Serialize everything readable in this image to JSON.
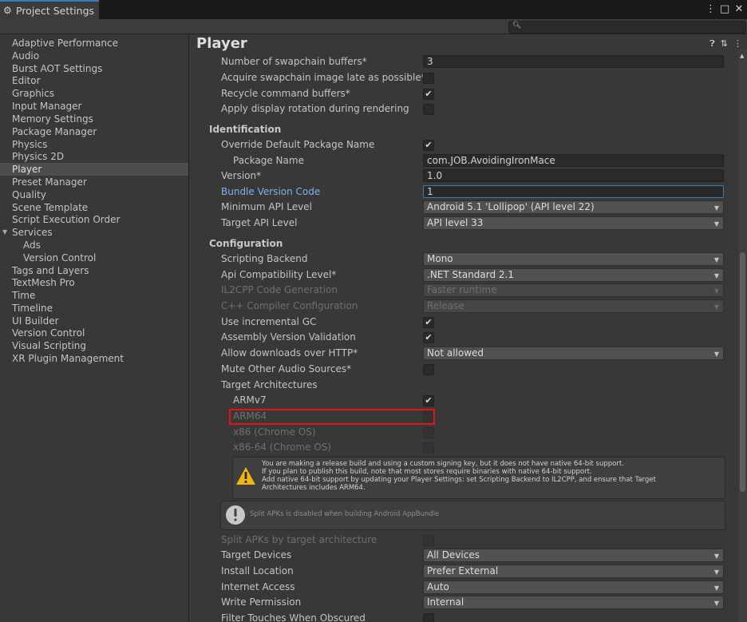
{
  "window": {
    "tab_title": "Project Settings",
    "controls": [
      "⋮",
      "□",
      "✕"
    ]
  },
  "search": {
    "placeholder": ""
  },
  "sidebar": {
    "items": [
      {
        "label": "Adaptive Performance"
      },
      {
        "label": "Audio"
      },
      {
        "label": "Burst AOT Settings"
      },
      {
        "label": "Editor"
      },
      {
        "label": "Graphics"
      },
      {
        "label": "Input Manager"
      },
      {
        "label": "Memory Settings"
      },
      {
        "label": "Package Manager"
      },
      {
        "label": "Physics"
      },
      {
        "label": "Physics 2D"
      },
      {
        "label": "Player",
        "selected": true
      },
      {
        "label": "Preset Manager"
      },
      {
        "label": "Quality"
      },
      {
        "label": "Scene Template"
      },
      {
        "label": "Script Execution Order"
      },
      {
        "label": "Services",
        "expanded": true
      },
      {
        "label": "Ads",
        "child": true
      },
      {
        "label": "Version Control",
        "child": true
      },
      {
        "label": "Tags and Layers"
      },
      {
        "label": "TextMesh Pro"
      },
      {
        "label": "Time"
      },
      {
        "label": "Timeline"
      },
      {
        "label": "UI Builder"
      },
      {
        "label": "Version Control"
      },
      {
        "label": "Visual Scripting"
      },
      {
        "label": "XR Plugin Management"
      }
    ]
  },
  "main": {
    "title": "Player",
    "header_icons": [
      "help-icon",
      "preset-icon",
      "more-icon"
    ],
    "rows": {
      "swapchain_buffers": {
        "label": "Number of swapchain buffers*",
        "value": "3"
      },
      "acquire_late": {
        "label": "Acquire swapchain image late as possible*",
        "checked": false
      },
      "recycle_buffers": {
        "label": "Recycle command buffers*",
        "checked": true
      },
      "display_rotation": {
        "label": "Apply display rotation during rendering",
        "checked": false
      }
    },
    "identification": {
      "header": "Identification",
      "override_package": {
        "label": "Override Default Package Name",
        "checked": true
      },
      "package_name": {
        "label": "Package Name",
        "value": "com.JOB.AvoidingIronMace"
      },
      "version": {
        "label": "Version*",
        "value": "1.0"
      },
      "bundle_code": {
        "label": "Bundle Version Code",
        "value": "1"
      },
      "min_api": {
        "label": "Minimum API Level",
        "value": "Android 5.1 'Lollipop' (API level 22)"
      },
      "target_api": {
        "label": "Target API Level",
        "value": "API level 33"
      }
    },
    "configuration": {
      "header": "Configuration",
      "scripting_backend": {
        "label": "Scripting Backend",
        "value": "Mono"
      },
      "api_compat": {
        "label": "Api Compatibility Level*",
        "value": ".NET Standard 2.1"
      },
      "il2cpp_codegen": {
        "label": "IL2CPP Code Generation",
        "value": "Faster runtime",
        "disabled": true
      },
      "cpp_config": {
        "label": "C++ Compiler Configuration",
        "value": "Release",
        "disabled": true
      },
      "incremental_gc": {
        "label": "Use incremental GC",
        "checked": true
      },
      "assembly_validation": {
        "label": "Assembly Version Validation",
        "checked": true
      },
      "http_downloads": {
        "label": "Allow downloads over HTTP*",
        "value": "Not allowed"
      },
      "mute_audio": {
        "label": "Mute Other Audio Sources*",
        "checked": false
      },
      "target_arch": {
        "label": "Target Architectures"
      },
      "armv7": {
        "label": "ARMv7",
        "checked": true
      },
      "arm64": {
        "label": "ARM64",
        "checked": false,
        "disabled": true
      },
      "x86": {
        "label": "x86 (Chrome OS)",
        "checked": false,
        "disabled": true
      },
      "x86_64": {
        "label": "x86-64 (Chrome OS)",
        "checked": false,
        "disabled": true
      },
      "warning": {
        "icon": "warning-icon",
        "line1": "You are making a release build and using a custom signing key, but it does not have native 64-bit support.",
        "line2": "If you plan to publish this build, note that most stores require binaries with native 64-bit support.",
        "line3": "Add native 64-bit support by updating your Player Settings: set Scripting Backend to IL2CPP, and ensure that Target",
        "line4": "Architectures includes ARM64."
      },
      "info": {
        "icon": "info-icon",
        "text": "Split APKs is disabled when building Android AppBundle"
      },
      "split_apks": {
        "label": "Split APKs by target architecture",
        "checked": false,
        "disabled": true
      },
      "target_devices": {
        "label": "Target Devices",
        "value": "All Devices"
      },
      "install_location": {
        "label": "Install Location",
        "value": "Prefer External"
      },
      "internet_access": {
        "label": "Internet Access",
        "value": "Auto"
      },
      "write_permission": {
        "label": "Write Permission",
        "value": "Internal"
      },
      "filter_touches": {
        "label": "Filter Touches When Obscured",
        "checked": false
      }
    }
  },
  "colors": {
    "highlight": "#e01515",
    "link_blue": "#7fb2ed",
    "focus_blue": "#3a79bb"
  }
}
